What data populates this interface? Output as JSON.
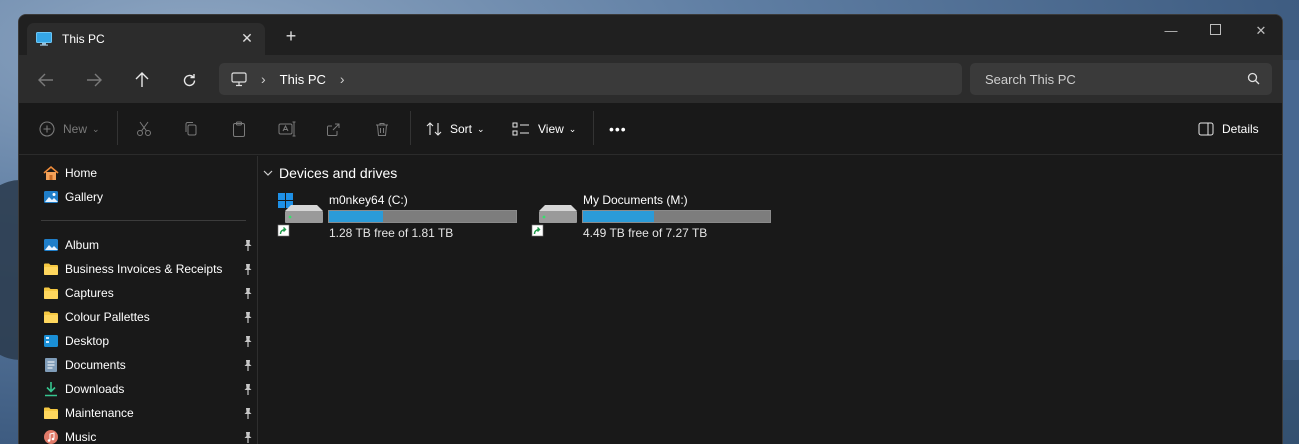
{
  "window": {
    "tab_title": "This PC",
    "new_tab": "+"
  },
  "address": {
    "crumbs": [
      "This PC"
    ],
    "search_placeholder": "Search This PC"
  },
  "toolbar": {
    "new_label": "New",
    "sort_label": "Sort",
    "view_label": "View",
    "more_label": "•••",
    "details_label": "Details"
  },
  "sidebar": {
    "top": [
      {
        "label": "Home",
        "icon": "home-icon"
      },
      {
        "label": "Gallery",
        "icon": "gallery-icon"
      }
    ],
    "pinned": [
      {
        "label": "Album",
        "icon": "album-icon"
      },
      {
        "label": "Business Invoices & Receipts",
        "icon": "folder-icon"
      },
      {
        "label": "Captures",
        "icon": "folder-icon"
      },
      {
        "label": "Colour Pallettes",
        "icon": "folder-icon"
      },
      {
        "label": "Desktop",
        "icon": "desktop-icon"
      },
      {
        "label": "Documents",
        "icon": "documents-icon"
      },
      {
        "label": "Downloads",
        "icon": "downloads-icon"
      },
      {
        "label": "Maintenance",
        "icon": "folder-icon"
      },
      {
        "label": "Music",
        "icon": "music-icon"
      }
    ]
  },
  "content": {
    "section_title": "Devices and drives",
    "drives": [
      {
        "name": "m0nkey64 (C:)",
        "free_text": "1.28 TB free of 1.81 TB",
        "used_fraction": 0.29,
        "system": true
      },
      {
        "name": "My Documents (M:)",
        "free_text": "4.49 TB free of 7.27 TB",
        "used_fraction": 0.38,
        "system": false
      }
    ]
  },
  "colors": {
    "accent": "#2b9bd8",
    "window_bg": "#191919",
    "chrome_bg": "#2c2c2c"
  }
}
